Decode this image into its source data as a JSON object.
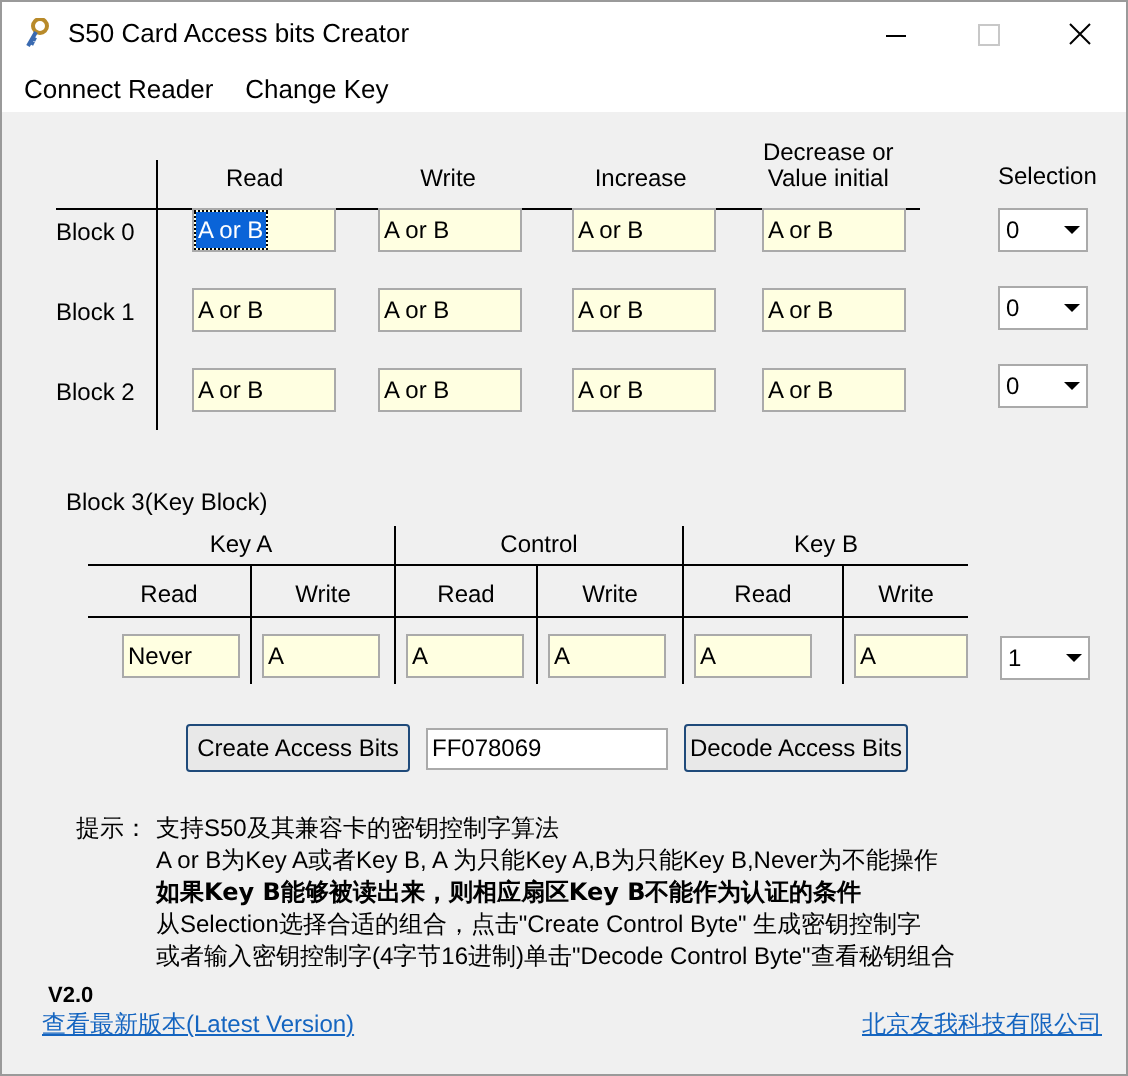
{
  "window": {
    "title": "S50 Card Access bits Creator"
  },
  "menu": [
    {
      "label": "Connect Reader"
    },
    {
      "label": "Change Key"
    }
  ],
  "data_blocks": {
    "columns": [
      "Read",
      "Write",
      "Increase",
      "Decrease or Value initial"
    ],
    "selection_header": "Selection",
    "rows": [
      {
        "label": "Block 0",
        "cells": [
          {
            "value": "A or B",
            "highlighted": true
          },
          {
            "value": "A or B",
            "highlighted": false
          },
          {
            "value": "A or B",
            "highlighted": false
          },
          {
            "value": "A or B",
            "highlighted": false
          }
        ],
        "selection": "0"
      },
      {
        "label": "Block 1",
        "cells": [
          {
            "value": "A or B",
            "highlighted": false
          },
          {
            "value": "A or B",
            "highlighted": false
          },
          {
            "value": "A or B",
            "highlighted": false
          },
          {
            "value": "A or B",
            "highlighted": false
          }
        ],
        "selection": "0"
      },
      {
        "label": "Block 2",
        "cells": [
          {
            "value": "A or B",
            "highlighted": false
          },
          {
            "value": "A or B",
            "highlighted": false
          },
          {
            "value": "A or B",
            "highlighted": false
          },
          {
            "value": "A or B",
            "highlighted": false
          }
        ],
        "selection": "0"
      }
    ]
  },
  "key_block": {
    "title": "Block 3(Key Block)",
    "groups": [
      {
        "name": "Key A",
        "columns": [
          {
            "header": "Read",
            "value": "Never"
          },
          {
            "header": "Write",
            "value": "A"
          }
        ]
      },
      {
        "name": "Control",
        "columns": [
          {
            "header": "Read",
            "value": "A"
          },
          {
            "header": "Write",
            "value": "A"
          }
        ]
      },
      {
        "name": "Key B",
        "columns": [
          {
            "header": "Read",
            "value": "A"
          },
          {
            "header": "Write",
            "value": "A"
          }
        ]
      }
    ],
    "selection": "1"
  },
  "actions": {
    "create_button": "Create Access Bits",
    "access_bits": "FF078069",
    "decode_button": "Decode Access Bits"
  },
  "tips": {
    "label": "提示：",
    "lines": [
      {
        "text": "支持S50及其兼容卡的密钥控制字算法",
        "bold": false
      },
      {
        "text": "A or B为Key A或者Key B, A 为只能Key A,B为只能Key B,Never为不能操作",
        "bold": false
      },
      {
        "text": "如果Key B能够被读出来，则相应扇区Key B不能作为认证的条件",
        "bold": true
      },
      {
        "text": "从Selection选择合适的组合，点击\"Create Control Byte\" 生成密钥控制字",
        "bold": false
      },
      {
        "text": "或者输入密钥控制字(4字节16进制)单击\"Decode Control Byte\"查看秘钥组合",
        "bold": false
      }
    ]
  },
  "footer": {
    "version": "V2.0",
    "latest_link": "查看最新版本(Latest Version)",
    "company_link": "北京友我科技有限公司"
  }
}
